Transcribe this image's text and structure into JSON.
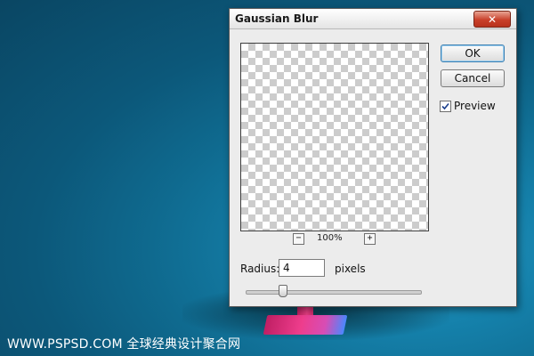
{
  "watermark": "WWW.PSPSD.COM 全球经典设计聚合网",
  "dialog": {
    "title": "Gaussian Blur",
    "close_icon": "close-icon",
    "ok_label": "OK",
    "cancel_label": "Cancel",
    "preview_label": "Preview",
    "preview_checked": true,
    "zoom_minus": "−",
    "zoom_plus": "+",
    "zoom_level": "100%",
    "radius_label": "Radius:",
    "radius_value": "4",
    "units_label": "pixels",
    "radius_slider_fraction": 0.21
  }
}
